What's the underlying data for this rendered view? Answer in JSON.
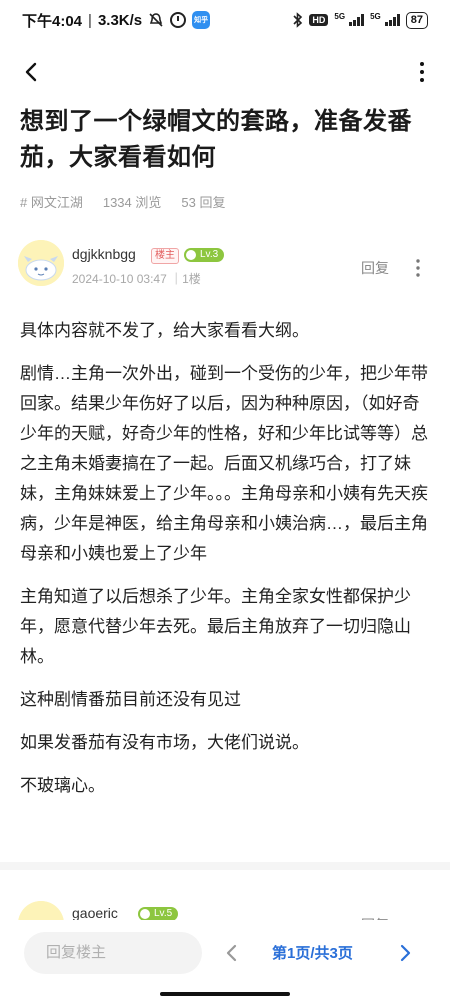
{
  "status_bar": {
    "time": "下午4:04",
    "network_speed": "3.3K/s",
    "battery": "87",
    "signal_1": "5G",
    "signal_2": "5G",
    "hd": "HD",
    "app_badge": "知乎"
  },
  "post": {
    "title": "想到了一个绿帽文的套路，准备发番茄，大家看看如何",
    "tag": "# 网文江湖",
    "views": "1334 浏览",
    "replies": "53 回复",
    "author": {
      "name": "dgjkknbgg",
      "owner_label": "楼主",
      "level": "Lv.3",
      "date": "2024-10-10 03:47 ｜1楼",
      "reply_label": "回复"
    },
    "paragraphs": [
      "具体内容就不发了，给大家看看大纲。",
      "剧情…主角一次外出，碰到一个受伤的少年，把少年带回家。结果少年伤好了以后，因为种种原因，（如好奇少年的天赋，好奇少年的性格，好和少年比试等等）总之主角未婚妻搞在了一起。后面又机缘巧合，打了妹妹，主角妹妹爱上了少年。。。主角母亲和小姨有先天疾病，少年是神医，给主角母亲和小姨治病…，最后主角母亲和小姨也爱上了少年",
      "主角知道了以后想杀了少年。主角全家女性都保护少年，愿意代替少年去死。最后主角放弃了一切归隐山林。",
      "这种剧情番茄目前还没有见过",
      "如果发番茄有没有市场，大佬们说说。",
      "不玻璃心。"
    ]
  },
  "second_post": {
    "author": "gaoeric",
    "level": "Lv.5",
    "reply_label": "回复"
  },
  "bottom_bar": {
    "reply_placeholder": "回复楼主",
    "page_indicator": "第1页/共3页"
  },
  "colors": {
    "accent": "#2a6fd8",
    "level_badge": "#8dc63f",
    "owner_badge": "#e25b5b"
  }
}
